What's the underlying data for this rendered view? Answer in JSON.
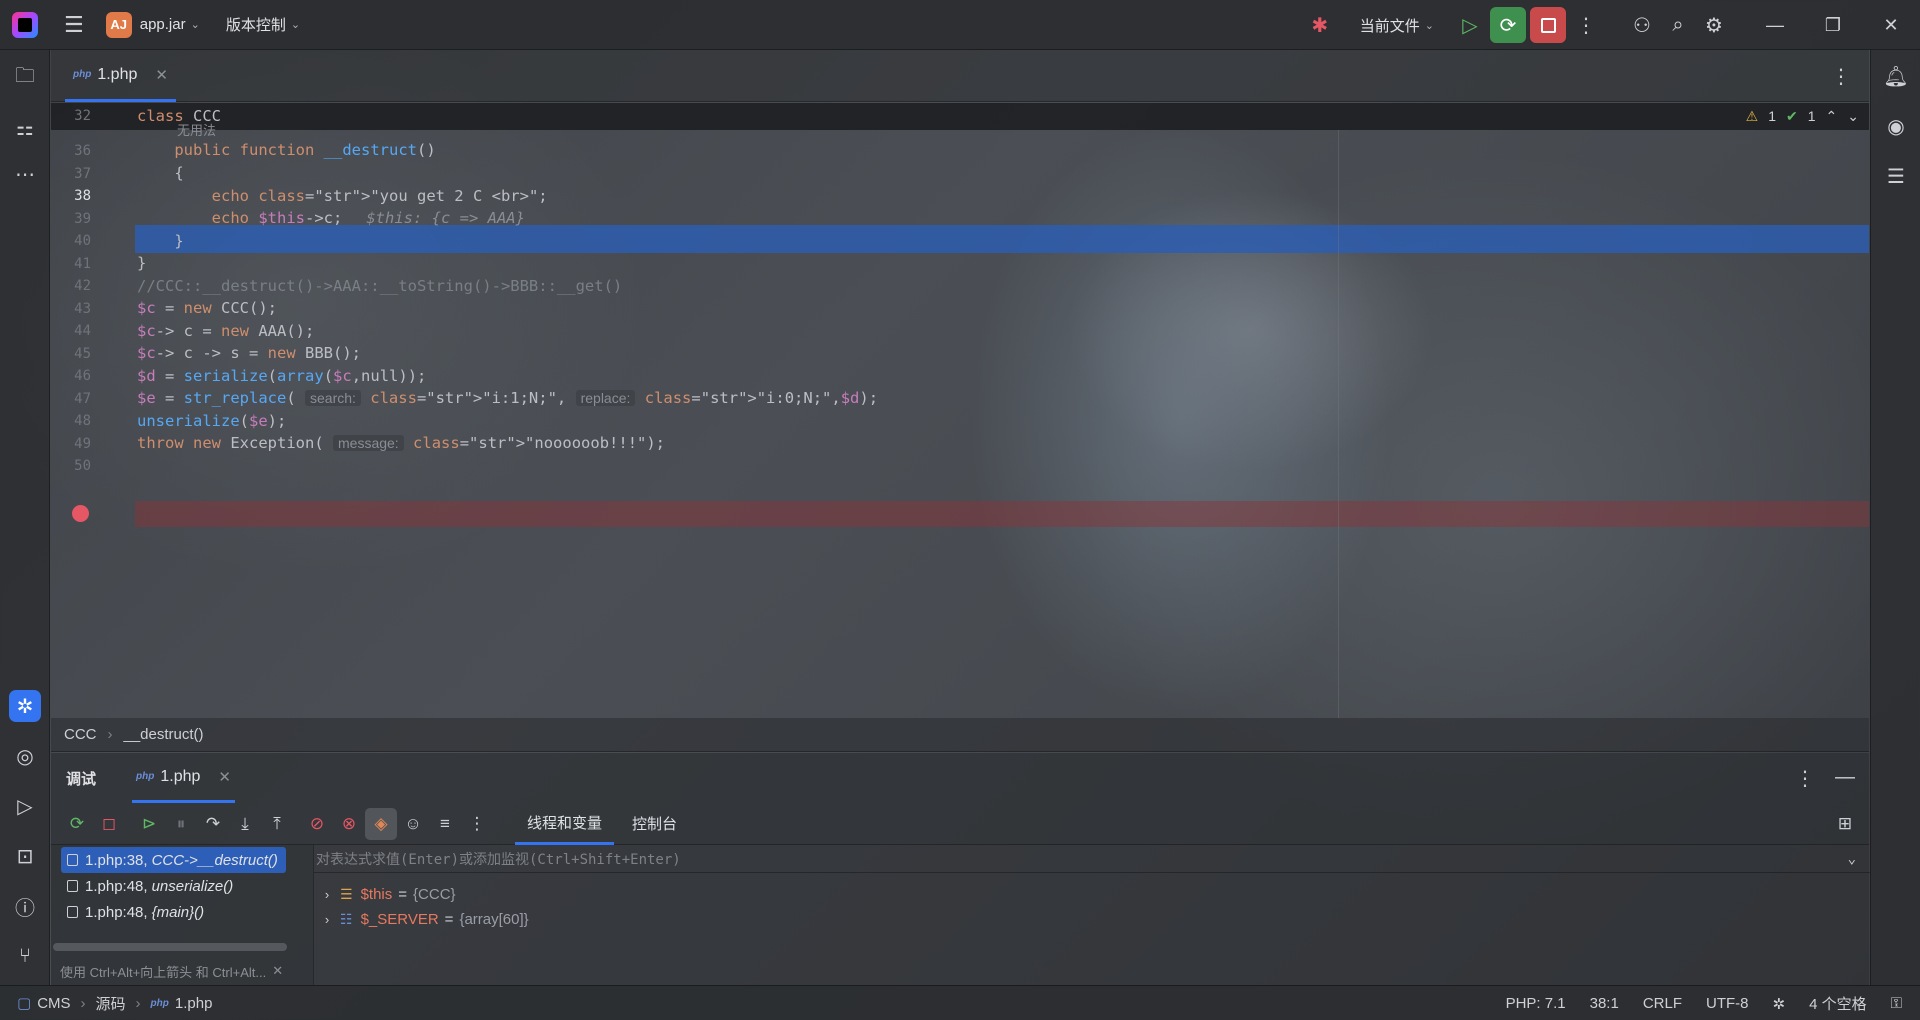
{
  "topbar": {
    "project_badge": "AJ",
    "project_name": "app.jar",
    "vcs_label": "版本控制",
    "run_config": "当前文件"
  },
  "editor_tab": {
    "filename": "1.php",
    "file_type": "php"
  },
  "inspections": {
    "warnings": "1",
    "ok": "1"
  },
  "sticky": {
    "line": "32",
    "text": "class CCC"
  },
  "code": {
    "unused_hint": "无用法",
    "lines": [
      {
        "num": "36",
        "text": "public function __destruct()"
      },
      {
        "num": "37",
        "text": "{"
      },
      {
        "num": "38",
        "text": "echo \"you get 2 C <br>\";"
      },
      {
        "num": "39",
        "text": "echo $this->c;"
      },
      {
        "num": "40",
        "text": "}"
      },
      {
        "num": "41",
        "text": "}"
      },
      {
        "num": "42",
        "text": "//CCC::__destruct()->AAA::__toString()->BBB::__get()"
      },
      {
        "num": "43",
        "text": "$c = new CCC();"
      },
      {
        "num": "44",
        "text": "$c-> c = new AAA();"
      },
      {
        "num": "45",
        "text": "$c-> c -> s = new BBB();"
      },
      {
        "num": "46",
        "text": "$d = serialize(array($c,null));"
      },
      {
        "num": "47",
        "text": "$e = str_replace( search: \"i:1;N;\", replace: \"i:0;N;\",$d);"
      },
      {
        "num": "48",
        "text": "unserialize($e);"
      },
      {
        "num": "49",
        "text": "throw new Exception( message: \"noooooob!!!\");"
      },
      {
        "num": "50",
        "text": ""
      }
    ],
    "inline_value_39": "$this: {c => AAA}",
    "hint_search": "search:",
    "hint_replace": "replace:",
    "hint_message": "message:"
  },
  "breadcrumb": [
    "CCC",
    "__destruct()"
  ],
  "debug": {
    "title": "调试",
    "session_tab": "1.php",
    "subtabs": [
      "线程和变量",
      "控制台"
    ],
    "frames": [
      {
        "loc": "1.php:38,",
        "fn": "CCC->__destruct()"
      },
      {
        "loc": "1.php:48,",
        "fn": "unserialize()"
      },
      {
        "loc": "1.php:48,",
        "fn": "{main}()"
      }
    ],
    "eval_placeholder": "对表达式求值(Enter)或添加监视(Ctrl+Shift+Enter)",
    "variables": [
      {
        "name": "$this",
        "value": "{CCC}"
      },
      {
        "name": "$_SERVER",
        "value": "{array[60]}"
      }
    ],
    "frames_tip": "使用 Ctrl+Alt+向上箭头 和 Ctrl+Alt..."
  },
  "statusbar": {
    "path": [
      "CMS",
      "源码",
      "1.php"
    ],
    "php_version": "PHP: 7.1",
    "position": "38:1",
    "line_sep": "CRLF",
    "encoding": "UTF-8",
    "indent": "4 个空格"
  }
}
